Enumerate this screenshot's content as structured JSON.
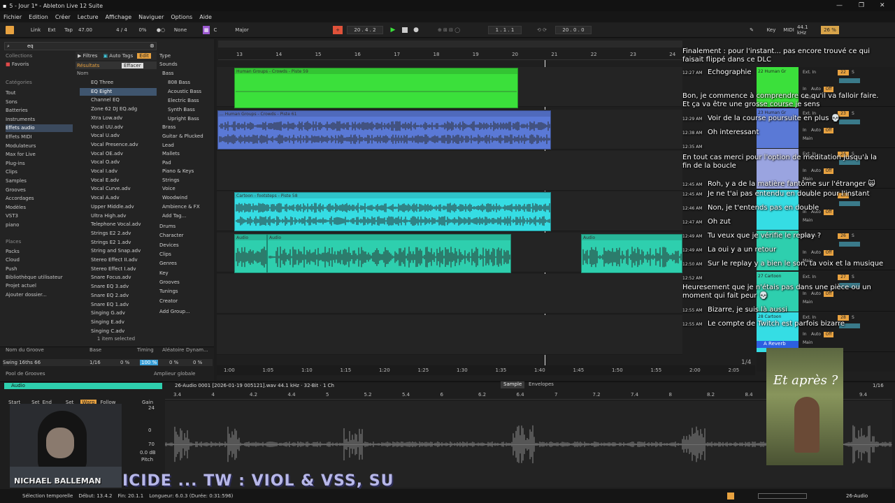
{
  "window": {
    "title": "5 - Jour 1* - Ableton Live 12 Suite"
  },
  "menu": [
    "Fichier",
    "Edition",
    "Créer",
    "Lecture",
    "Affichage",
    "Naviguer",
    "Options",
    "Aide"
  ],
  "transport": {
    "link": "Link",
    "ext": "Ext",
    "tap": "Tap",
    "tempo": "47.00",
    "signature": "4 / 4",
    "quantize_pct": "0%",
    "metro": "None",
    "key": "C",
    "scale": "Major",
    "position": "20 . 4 . 2",
    "loop_start": "1 . 1 . 1",
    "loop_len": "20 . 0 . 0",
    "key_btn": "Key",
    "midi": "MIDI",
    "sample_rate": "44.1 kHz",
    "cpu": "26 %"
  },
  "browser": {
    "search": "eq",
    "filter_label": "Filtres",
    "autotags_label": "Auto Tags",
    "edit_label": "Edit",
    "results_label": "Résultats",
    "effacer": "Effacer",
    "col_nom": "Nom",
    "collections_head": "Collections",
    "favoris": "Favoris",
    "categories_head": "Catégories",
    "categories": [
      "Tout",
      "Sons",
      "Batteries",
      "Instruments",
      "Effets audio",
      "Effets MIDI",
      "Modulateurs",
      "Max for Live",
      "Plug-ins",
      "Clips",
      "Samples",
      "Grooves",
      "Accordages",
      "Modèles",
      "VST3",
      "piano"
    ],
    "places_head": "Places",
    "places": [
      "Packs",
      "Cloud",
      "Push",
      "Bibliothèque utilisateur",
      "Projet actuel",
      "Ajouter dossier..."
    ],
    "results": [
      "EQ Three",
      "EQ Eight",
      "Channel EQ",
      "Zone 62 DJ EQ.adg",
      "Xtra Low.adv",
      "Vocal UU.adv",
      "Vocal U.adv",
      "Vocal Presence.adv",
      "Vocal OE.adv",
      "Vocal O.adv",
      "Vocal I.adv",
      "Vocal E.adv",
      "Vocal Curve.adv",
      "Vocal A.adv",
      "Upper Middle.adv",
      "Ultra High.adv",
      "Telephone Vocal.adv",
      "Strings E2 2.adv",
      "Strings E2 1.adv",
      "String and Snap.adv",
      "Stereo Effect II.adv",
      "Stereo Effect I.adv",
      "Snare Focus.adv",
      "Snare EQ 3.adv",
      "Snare EQ 2.adv",
      "Snare EQ 1.adv",
      "Singing G.adv",
      "Singing E.adv",
      "Singing C.adv"
    ],
    "selected_info": "1 item selected",
    "tags_head": "Type",
    "tags": [
      "Sounds",
      "Bass",
      "808 Bass",
      "Acoustic Bass",
      "Electric Bass",
      "Synth Bass",
      "Upright Bass",
      "Brass",
      "Guitar & Plucked",
      "Lead",
      "Mallets",
      "Pad",
      "Piano & Keys",
      "Strings",
      "Voice",
      "Woodwind",
      "Ambience & FX",
      "Add Tag...",
      "Drums",
      "Character",
      "Devices",
      "Clips",
      "Genres",
      "Key",
      "Grooves",
      "Tunings",
      "Creator",
      "Add Group..."
    ]
  },
  "groove": {
    "headers": [
      "Nom du Groove",
      "Base",
      "Timing",
      "Aléatoire",
      "Dynam..."
    ],
    "name": "Swing 16ths 66",
    "base": "1/16",
    "v1": "0 %",
    "v2": "100 %",
    "v3": "0 %",
    "v4": "0 %",
    "pool": "Pool de Grooves",
    "ampl": "Amplieur globale",
    "ampl_val": "100 %"
  },
  "ruler": [
    "13",
    "14",
    "15",
    "16",
    "17",
    "18",
    "19",
    "20",
    "21",
    "22",
    "23",
    "24"
  ],
  "time_ruler": [
    "1:00",
    "1:05",
    "1:10",
    "1:15",
    "1:20",
    "1:25",
    "1:30",
    "1:35",
    "1:40",
    "1:45",
    "1:50",
    "1:55",
    "2:00",
    "2:05"
  ],
  "clips": [
    {
      "name": "Human Groups - Crowds - Piste 59",
      "color": "#3be03b"
    },
    {
      "name": "... Human Groups - Crowds - Piste 61",
      "color": "#5a79d6"
    },
    {
      "name": "Cartoon - footsteps - Piste 58",
      "color": "#35dde4"
    },
    {
      "name": "Audio",
      "color": "#2ecfae"
    },
    {
      "name": "Audio",
      "color": "#2ecfae"
    },
    {
      "name": "Audio",
      "color": "#2ecfae"
    }
  ],
  "tracks": [
    {
      "name": "22 Human Gr",
      "num": "22",
      "color": "#3be03b"
    },
    {
      "name": "23 Human Gr",
      "num": "23",
      "color": "#5a79d6"
    },
    {
      "name": "",
      "num": "24",
      "color": "#9aa4e0"
    },
    {
      "name": "",
      "num": "25",
      "color": "#35dde4"
    },
    {
      "name": "",
      "num": "26",
      "color": "#2ecfae"
    },
    {
      "name": "27 Cartoon",
      "num": "27",
      "color": "#2ecfae"
    },
    {
      "name": "28 Cartoon",
      "num": "28",
      "color": "#35dde4"
    }
  ],
  "mixer": {
    "ext_in": "Ext. In",
    "in": "In",
    "auto": "Auto",
    "off": "Off",
    "main": "Main",
    "reverb": "A Reverb",
    "post": "Post",
    "frac": "1/4",
    "vol": "-6.0"
  },
  "chat": [
    {
      "ts": "",
      "text": "Finalement : pour l'instant... pas encore trouvé ce qui faisait flippé dans ce DLC"
    },
    {
      "ts": "12:27 AM",
      "text": "Echographie"
    },
    {
      "ts": "",
      "text": "Bon, je commence à comprendre ce qu'il va falloir faire. Et ça va être une grosse course je sens"
    },
    {
      "ts": "12:29 AM",
      "text": "Voir de la course poursuite en plus 💀"
    },
    {
      "ts": "12:38 AM",
      "text": "Oh interessant"
    },
    {
      "ts": "12:35 AM",
      "text": ""
    },
    {
      "ts": "",
      "text": "En tout cas merci pour l'option de meditation jusqu'à la fin de la boucle"
    },
    {
      "ts": "12:45 AM",
      "text": "Roh, y a de la matière fantôme sur l'étranger 🙀"
    },
    {
      "ts": "12:45 AM",
      "text": "Je ne t'ai pas entendu en double pour l'instant"
    },
    {
      "ts": "12:46 AM",
      "text": "Non, je t'entends pas en double"
    },
    {
      "ts": "12:47 AM",
      "text": "Oh zut"
    },
    {
      "ts": "12:49 AM",
      "text": "Tu veux que je vérifie le replay ?"
    },
    {
      "ts": "12:49 AM",
      "text": "La oui y a un retour"
    },
    {
      "ts": "12:50 AM",
      "text": "Sur le replay y a bien le son, ta voix et la musique"
    },
    {
      "ts": "12:52 AM",
      "text": ""
    },
    {
      "ts": "",
      "text": "Heuresement que je n'étais pas dans une pièce ou un moment qui fait peur 💀"
    },
    {
      "ts": "12:55 AM",
      "text": "Bizarre, je suis là aussi"
    },
    {
      "ts": "12:55 AM",
      "text": "Le compte de Twitch est parfois bizarre"
    }
  ],
  "detail": {
    "clip_title": "Audio",
    "file": "26-Audio 0001 [2026-01-19 005121].wav  44.1 kHz · 32-Bit · 1 Ch",
    "tab_sample": "Sample",
    "tab_env": "Envelopes",
    "start": "Start",
    "end": "End",
    "set": "Set",
    "warp": "Warp",
    "follow": "Follow",
    "gain": "Gain",
    "gain_val": "0.0 dB",
    "pitch": "Pitch",
    "frac": "1/16",
    "ticks": [
      "3.4",
      "4",
      "4.2",
      "4.4",
      "5",
      "5.2",
      "5.4",
      "6",
      "6.2",
      "6.4",
      "7",
      "7.2",
      "7.4",
      "8",
      "8.2",
      "8.4",
      "9",
      "9.2",
      "9.4"
    ],
    "meter": [
      "24",
      "0",
      "70"
    ]
  },
  "status": {
    "sel": "Sélection temporelle",
    "debut": "Début: 13.4.2",
    "fin": "Fin: 20.1.1",
    "longueur": "Longueur: 6.0.3 (Durée: 0:31:596)",
    "track": "26-Audio"
  },
  "overlay": {
    "banner": "ICIDE ... TW : VIOL & VSS, SU",
    "poster_title": "Et après ?",
    "webcam_name": "NICHAEL BALLEMAN"
  }
}
